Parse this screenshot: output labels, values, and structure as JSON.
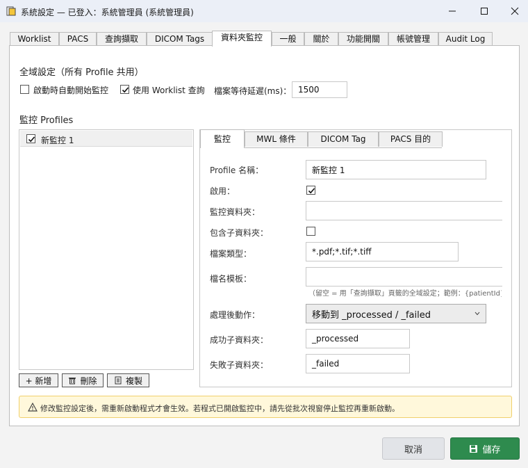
{
  "window": {
    "title": "系統設定 — 已登入：系統管理員 (系統管理員)"
  },
  "tabs": [
    "Worklist",
    "PACS",
    "查詢擷取",
    "DICOM Tags",
    "資料夾監控",
    "一般",
    "關於",
    "功能開關",
    "帳號管理",
    "Audit Log"
  ],
  "active_tab": "資料夾監控",
  "global": {
    "title": "全域設定（所有 Profile 共用）",
    "auto_start_label": "啟動時自動開始監控",
    "auto_start_checked": false,
    "use_worklist_label": "使用 Worklist 查詢",
    "use_worklist_checked": true,
    "delay_label": "檔案等待延遲(ms)：",
    "delay_value": "1500"
  },
  "profiles": {
    "title": "監控 Profiles",
    "items": [
      {
        "name": "新監控 1",
        "checked": true
      }
    ],
    "add_label": "+ 新增",
    "delete_label": "刪除",
    "copy_label": "複製"
  },
  "inner_tabs": [
    "監控",
    "MWL 條件",
    "DICOM Tag",
    "PACS 目的"
  ],
  "inner_active_tab": "監控",
  "form": {
    "profile_name_label": "Profile 名稱：",
    "profile_name_value": "新監控 1",
    "enabled_label": "啟用：",
    "enabled_checked": true,
    "folder_label": "監控資料夾：",
    "folder_value": "",
    "subfolders_label": "包含子資料夾：",
    "subfolders_checked": false,
    "filetype_label": "檔案類型：",
    "filetype_value": "*.pdf;*.tif;*.tiff",
    "template_label": "檔名模板：",
    "template_value": "",
    "template_hint": "（留空 = 用「查詢擷取」頁籤的全域設定；範例：{patientId}_{accessionNumber}",
    "after_label": "處理後動作：",
    "after_value": "移動到 _processed / _failed",
    "success_label": "成功子資料夾：",
    "success_value": "_processed",
    "fail_label": "失敗子資料夾：",
    "fail_value": "_failed"
  },
  "warning": {
    "text": "修改監控設定後，需重新啟動程式才會生效。若程式已開啟監控中，請先從批次視窗停止監控再重新啟動。"
  },
  "footer": {
    "cancel_label": "取消",
    "save_label": "儲存"
  },
  "colors": {
    "save_green": "#2e8b4e",
    "warning_bg": "#fff8db",
    "titlebar_bg": "#ebeff7"
  }
}
